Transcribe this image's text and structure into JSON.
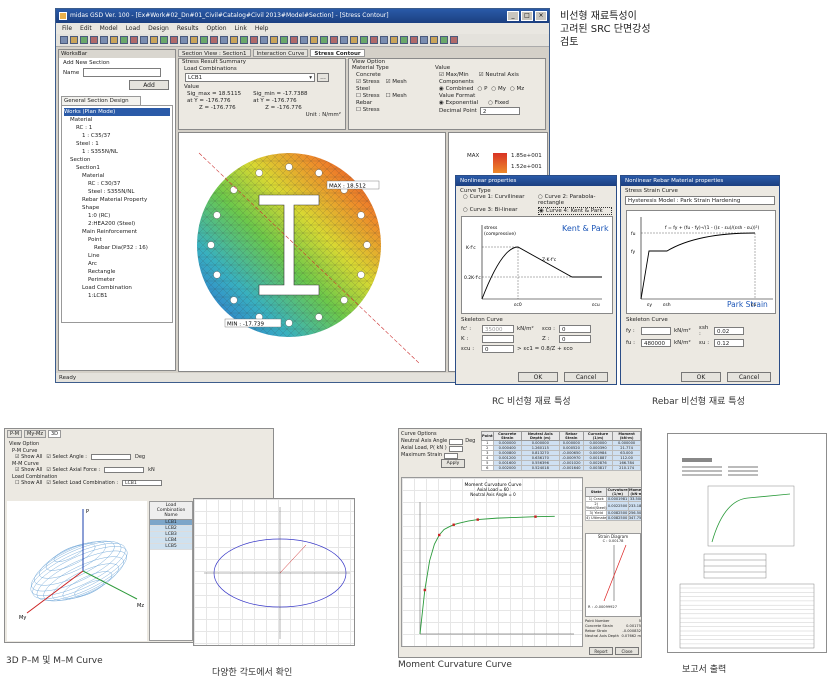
{
  "side_text": {
    "line1": "비선형 재료특성이",
    "line2": "고려된 SRC 단면강성",
    "line3": "검토"
  },
  "window": {
    "title": "midas GSD Ver. 100 - [Ex#Work#02_Dn#01_Civil#Catalog#Civil 2013#Model#Section] - [Stress Contour]",
    "menu": [
      "File",
      "Edit",
      "Model",
      "Load",
      "Design",
      "Results",
      "Option",
      "Link",
      "Help"
    ],
    "status": "Ready"
  },
  "worksbar": {
    "title": "WorksBar",
    "add_section": "Add New Section",
    "name_label": "Name",
    "add_btn": "Add",
    "tab": "General Section Design",
    "tree": [
      "Works (Plan Mode)",
      "Material",
      "RC : 1",
      "1 : C35/37",
      "Steel : 1",
      "1 : S355N/NL",
      "Section",
      "Section1",
      "Material",
      "RC : C30/37",
      "Steel : S355N/NL",
      "Rebar Material Property",
      "Shape",
      "1:0 (RC)",
      "2:HEA200 (Steel)",
      "Main Reinforcement",
      "Point",
      "Rebar Dia(P32 : 16)",
      "Line",
      "Arc",
      "Rectangle",
      "Perimeter",
      "Load Combination",
      "1:LCB1"
    ]
  },
  "tabs": [
    "Section View : Section1",
    "Interaction Curve",
    "Stress Contour"
  ],
  "summary": {
    "title": "Stress Result Summary",
    "load_comb_label": "Load Combinations",
    "load_comb_value": "LCB1",
    "value_label": "Value",
    "sig_max": "Sig_max = 18.5115",
    "sig_max_y": "at  Y = -176.776",
    "sig_max_z": "Z = -176.776",
    "sig_min": "Sig_min = -17.7388",
    "sig_min_y": "at  Y = -176.776",
    "sig_min_z": "Z = -176.776",
    "unit": "Unit : N/mm²"
  },
  "view_option": {
    "title": "View Option",
    "material_type": "Material Type",
    "concrete": "Concrete",
    "stress": "Stress",
    "mesh": "Mesh",
    "steel": "Steel",
    "rebar": "Rebar",
    "value": "Value",
    "maxmin": "Max/Min",
    "neutral_axis": "Neutral Axis",
    "components": "Components",
    "combined": "Combined",
    "p": "P",
    "my": "My",
    "mz": "Mz",
    "value_format": "Value Format",
    "exponential": "Exponential",
    "fixed": "Fixed",
    "decimal_point": "Decimal Point",
    "decimal_value": "2"
  },
  "contour": {
    "max_label": "MAX : 18.512",
    "min_label": "MIN : -17.739",
    "legend_max": "MAX",
    "legend_v1": "1.85e+001",
    "legend_v2": "1.52e+001"
  },
  "dlg_concrete": {
    "title": "Nonlinear properties",
    "curve_type": "Curve Type",
    "c1": "Curve 1: Curvilinear",
    "c2": "Curve 2: Parabola-rectangle",
    "c3": "Curve 3: Bi-linear",
    "c4": "Curve 4: Kent & Park",
    "graph_title": "Kent & Park",
    "stress_label": "stress",
    "compression": "(compressive)",
    "kfc": "K·f'c",
    "zk": "Z·K·f'c",
    "lfc": "0.2K·f'c",
    "e0": "εc0",
    "ecu": "εcu",
    "skeleton": "Skeleton Curve",
    "fc": "fc' :",
    "fc_val": "35000",
    "fc_unit": "kN/m²",
    "eco": "εco :",
    "eco_val": "0",
    "k": "K :",
    "k_val": "",
    "z": "Z :",
    "z_val": "0",
    "ecu2": "εcu :",
    "ecu_val": "0",
    "ecu_note": "> εc1 = 0.8/Z + εco",
    "ok": "OK",
    "cancel": "Cancel"
  },
  "dlg_rebar": {
    "title": "Nonlinear Rebar Material properties",
    "stress_strain": "Stress Strain Curve",
    "model": "Hysteresis Model : Park Strain Hardening",
    "graph_title": "Park Strain",
    "formula": "f = fy + (fu - fy)·√(1 - ((ε - εu)/(εsh - εu))²)",
    "fu": "fu",
    "fy": "fy",
    "ey": "εy",
    "esh": "εsh",
    "eu": "εu",
    "skeleton": "Skeleton Curve",
    "fy_label": "fy :",
    "fy_val": "",
    "fy_unit": "kN/m²",
    "esh_label": "εsh :",
    "esh_val": "0.02",
    "fu_label": "fu :",
    "fu_val": "480000",
    "fu_unit": "kN/m²",
    "eu_label": "εu :",
    "eu_val": "0.12",
    "ok": "OK",
    "cancel": "Cancel"
  },
  "captions": {
    "rc": "RC 비선형 재료 특성",
    "rebar": "Rebar 비선형 재료 특성",
    "pm": "3D P–M 및 M–M Curve",
    "angles": "다양한 각도에서 확인",
    "moment": "Moment Curvature Curve",
    "report": "보고서 출력"
  },
  "pm_window": {
    "tabs": [
      "P-M",
      "My-Mz",
      "3D"
    ],
    "view_option": "View Option",
    "pm_curve": "P-M Curve",
    "show_all": "Show All",
    "select_angle": "Select Angle :",
    "deg": "Deg",
    "mm_curve": "M-M Curve",
    "select_axial": "Select Axial Force :",
    "kn": "kN",
    "load_comb": "Load Combination",
    "select_lcb": "Select Load Combination :",
    "lcb": "LCB1",
    "axis_p": "P",
    "axis_my": "My",
    "axis_mz": "Mz",
    "lcb_header": "Load Combination Name",
    "lcb_list": [
      "LCB1",
      "LCB2",
      "LCB3",
      "LCB4",
      "LCB5"
    ]
  },
  "moment_window": {
    "curve_options": "Curve Options",
    "na_angle": "Neutral Axis Angle",
    "deg": "Deg",
    "axial_load": "Axial Load, P( kN )",
    "max_strain": "Maximum Strain",
    "apply": "Apply",
    "chart_title": "Moment Curvature Curve",
    "chart_sub1": "Axial Load = 60",
    "chart_sub2": "Neutral Axis Angle = 0",
    "table_headers": [
      "Point",
      "Concrete Strain",
      "Neutral Axis Depth (m)",
      "Rebar Strain",
      "Curvature (1/m)",
      "Moment (kN·m)"
    ],
    "table_rows": [
      [
        "1",
        "0.000000",
        "0.000000",
        "0.000000",
        "0.000000",
        "0.000000"
      ],
      [
        "2",
        "0.000400",
        "1.260115",
        "0.000520",
        "0.000390",
        "21.774"
      ],
      [
        "3",
        "0.000800",
        "0.813270",
        "-0.000650",
        "0.000984",
        "63.000"
      ],
      [
        "4",
        "0.001200",
        "0.636170",
        "-0.000970",
        "0.001887",
        "112.00"
      ],
      [
        "5",
        "0.001600",
        "0.556396",
        "-0.001020",
        "0.002876",
        "166.784"
      ],
      [
        "6",
        "0.002000",
        "0.524018",
        "-0.001640",
        "0.003817",
        "210.174"
      ]
    ],
    "state_headers": [
      "State",
      "Curvature (1/m)",
      "Moment (kN·m)"
    ],
    "state_rows": [
      [
        "1) Crack",
        "0.0001981",
        "33.5082"
      ],
      [
        "2) Yield(Steel)",
        "0.0022500",
        "233.1805"
      ],
      [
        "3) Yield",
        "0.0082500",
        "256.5060"
      ],
      [
        "4) Ultimate",
        "0.0082500",
        "347.7550"
      ]
    ],
    "strain_diagram": "Strain Diagram",
    "strain_top": "C : 0.00178",
    "strain_bottom": "R : -0.00099927",
    "point_number": "Point Number",
    "point_val": "5",
    "conc_strain": "Concrete Strain",
    "conc_val": "0.00175",
    "rebar_strain": "Rebar Strain",
    "rebar_val": "-0.000832",
    "na_depth": "Neutral Axis Depth",
    "na_val": "0.07662 m",
    "report": "Report",
    "close": "Close"
  },
  "chart_data": {
    "type": "line",
    "title": "Moment Curvature Curve",
    "subtitle": [
      "Axial Load = 60",
      "Neutral Axis Angle = 0"
    ],
    "xlabel": "",
    "ylabel": "",
    "x": [
      0,
      0.5,
      1,
      1.5,
      2,
      2.5,
      3,
      3.5,
      4,
      5,
      6,
      8,
      10,
      12,
      14
    ],
    "series": [
      {
        "values": [
          0,
          120,
          200,
          245,
          270,
          285,
          292,
          298,
          302,
          308,
          312,
          316,
          318,
          320,
          321
        ]
      }
    ],
    "xlim": [
      0,
      16
    ],
    "ylim": [
      0,
      360
    ],
    "grid": true
  }
}
